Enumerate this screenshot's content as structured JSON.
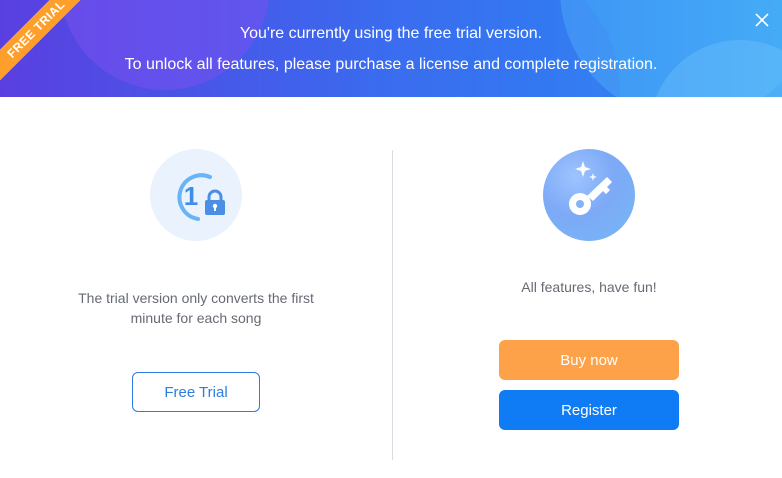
{
  "header": {
    "badge": "FREE TRIAL",
    "line1": "You're currently using the free trial version.",
    "line2": "To unlock all features, please purchase a license and complete registration."
  },
  "left": {
    "icon_digit": "1",
    "icon": "trial-lock-icon",
    "description_line1": "The trial version only converts the first",
    "description_line2": "minute for each song",
    "button_label": "Free Trial"
  },
  "right": {
    "icon": "key-icon",
    "description": "All features, have fun!",
    "buy_label": "Buy now",
    "register_label": "Register"
  },
  "colors": {
    "accent_orange": "#fea24a",
    "accent_blue": "#0f7cf5",
    "outline_blue": "#2b7de0",
    "badge_orange": "#ff9f2b"
  }
}
